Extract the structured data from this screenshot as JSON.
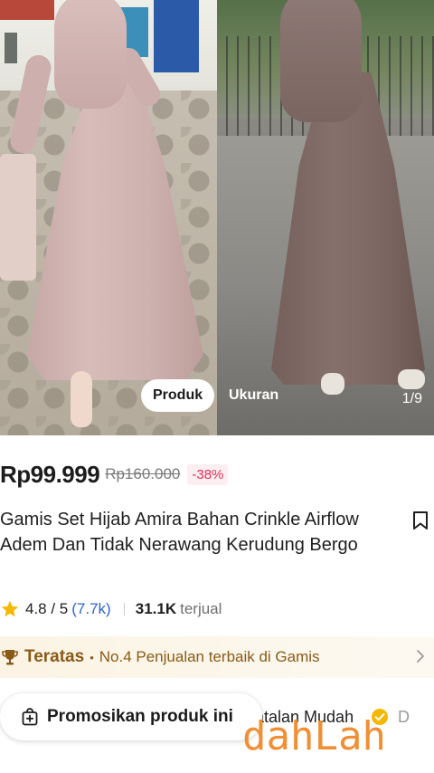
{
  "gallery": {
    "tabs": [
      {
        "label": "Produk",
        "active": true
      },
      {
        "label": "Ukuran",
        "active": false
      }
    ],
    "counter": "1/9"
  },
  "price": {
    "current": "Rp99.999",
    "original": "Rp160.000",
    "discount": "-38%"
  },
  "product": {
    "title": "Gamis Set Hijab Amira Bahan Crinkle Airflow Adem Dan Tidak Nerawang Kerudung Bergo",
    "bookmark_icon": "bookmark-icon"
  },
  "rating": {
    "score": "4.8 / 5",
    "reviews": "(7.7k)",
    "sold_count": "31.1K",
    "sold_label": "terjual"
  },
  "ranking": {
    "title": "Teratas",
    "text": "No.4 Penjualan terbaik di Gamis"
  },
  "bottom": {
    "promo_label": "Promosikan produk ini",
    "store_text": "atalan Mudah",
    "store_more": "D"
  },
  "watermark": "dahLah",
  "colors": {
    "discount": "#e0315a",
    "reviews_link": "#2f64c8",
    "ranking_text": "#8a5a17",
    "watermark": "#f08a2a"
  }
}
